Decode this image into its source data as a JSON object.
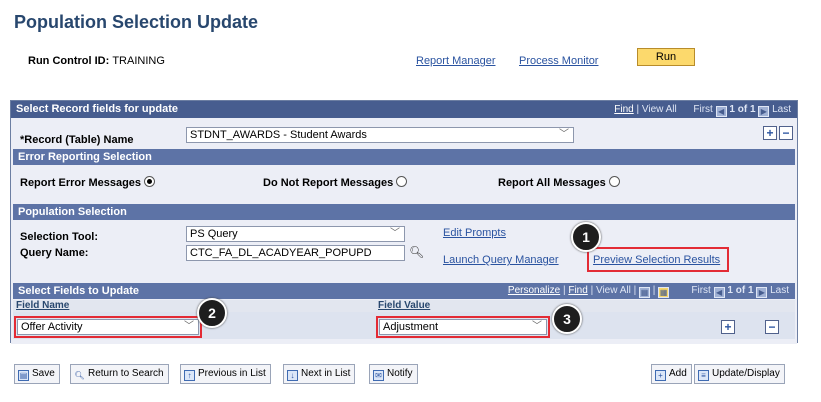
{
  "page_title": "Population Selection Update",
  "run_control": {
    "label": "Run Control ID:",
    "value": "TRAINING"
  },
  "top_links": {
    "report_manager": "Report Manager",
    "process_monitor": "Process Monitor"
  },
  "run_button": "Run",
  "record_section": {
    "title": "Select Record fields for update",
    "nav": {
      "find": "Find",
      "sep": "|",
      "view_all": "View All",
      "first": "First",
      "count": "1 of 1",
      "last": "Last"
    },
    "record_label": "*Record (Table) Name",
    "record_value": "STDNT_AWARDS - Student Awards",
    "add": "+",
    "remove": "−"
  },
  "error_section": {
    "title": "Error Reporting Selection",
    "opt1": "Report Error Messages",
    "opt2": "Do Not Report Messages",
    "opt3": "Report All Messages",
    "selected": "opt1"
  },
  "population_section": {
    "title": "Population Selection",
    "tool_label": "Selection Tool:",
    "tool_value": "PS Query",
    "query_label": "Query Name:",
    "query_value": "CTC_FA_DL_ACADYEAR_POPUPD",
    "edit_prompts": "Edit Prompts",
    "launch_query": "Launch Query Manager",
    "preview": "Preview Selection Results"
  },
  "fields_section": {
    "title": "Select Fields to Update",
    "nav": {
      "personalize": "Personalize",
      "sep": "|",
      "find": "Find",
      "view_all": "View All",
      "first": "First",
      "count": "1 of 1",
      "last": "Last"
    },
    "col_name": "Field Name",
    "col_value": "Field Value",
    "row_name": "Offer Activity",
    "row_value": "Adjustment",
    "add": "+",
    "remove": "−"
  },
  "callouts": [
    "1",
    "2",
    "3"
  ],
  "toolbar": {
    "save": "Save",
    "return": "Return to Search",
    "prev": "Previous in List",
    "next": "Next in List",
    "notify": "Notify",
    "add": "Add",
    "update": "Update/Display"
  },
  "colors": {
    "title": "#28476e",
    "header": "#475d8f",
    "highlight": "#e32b35",
    "run": "#fcd96c"
  }
}
